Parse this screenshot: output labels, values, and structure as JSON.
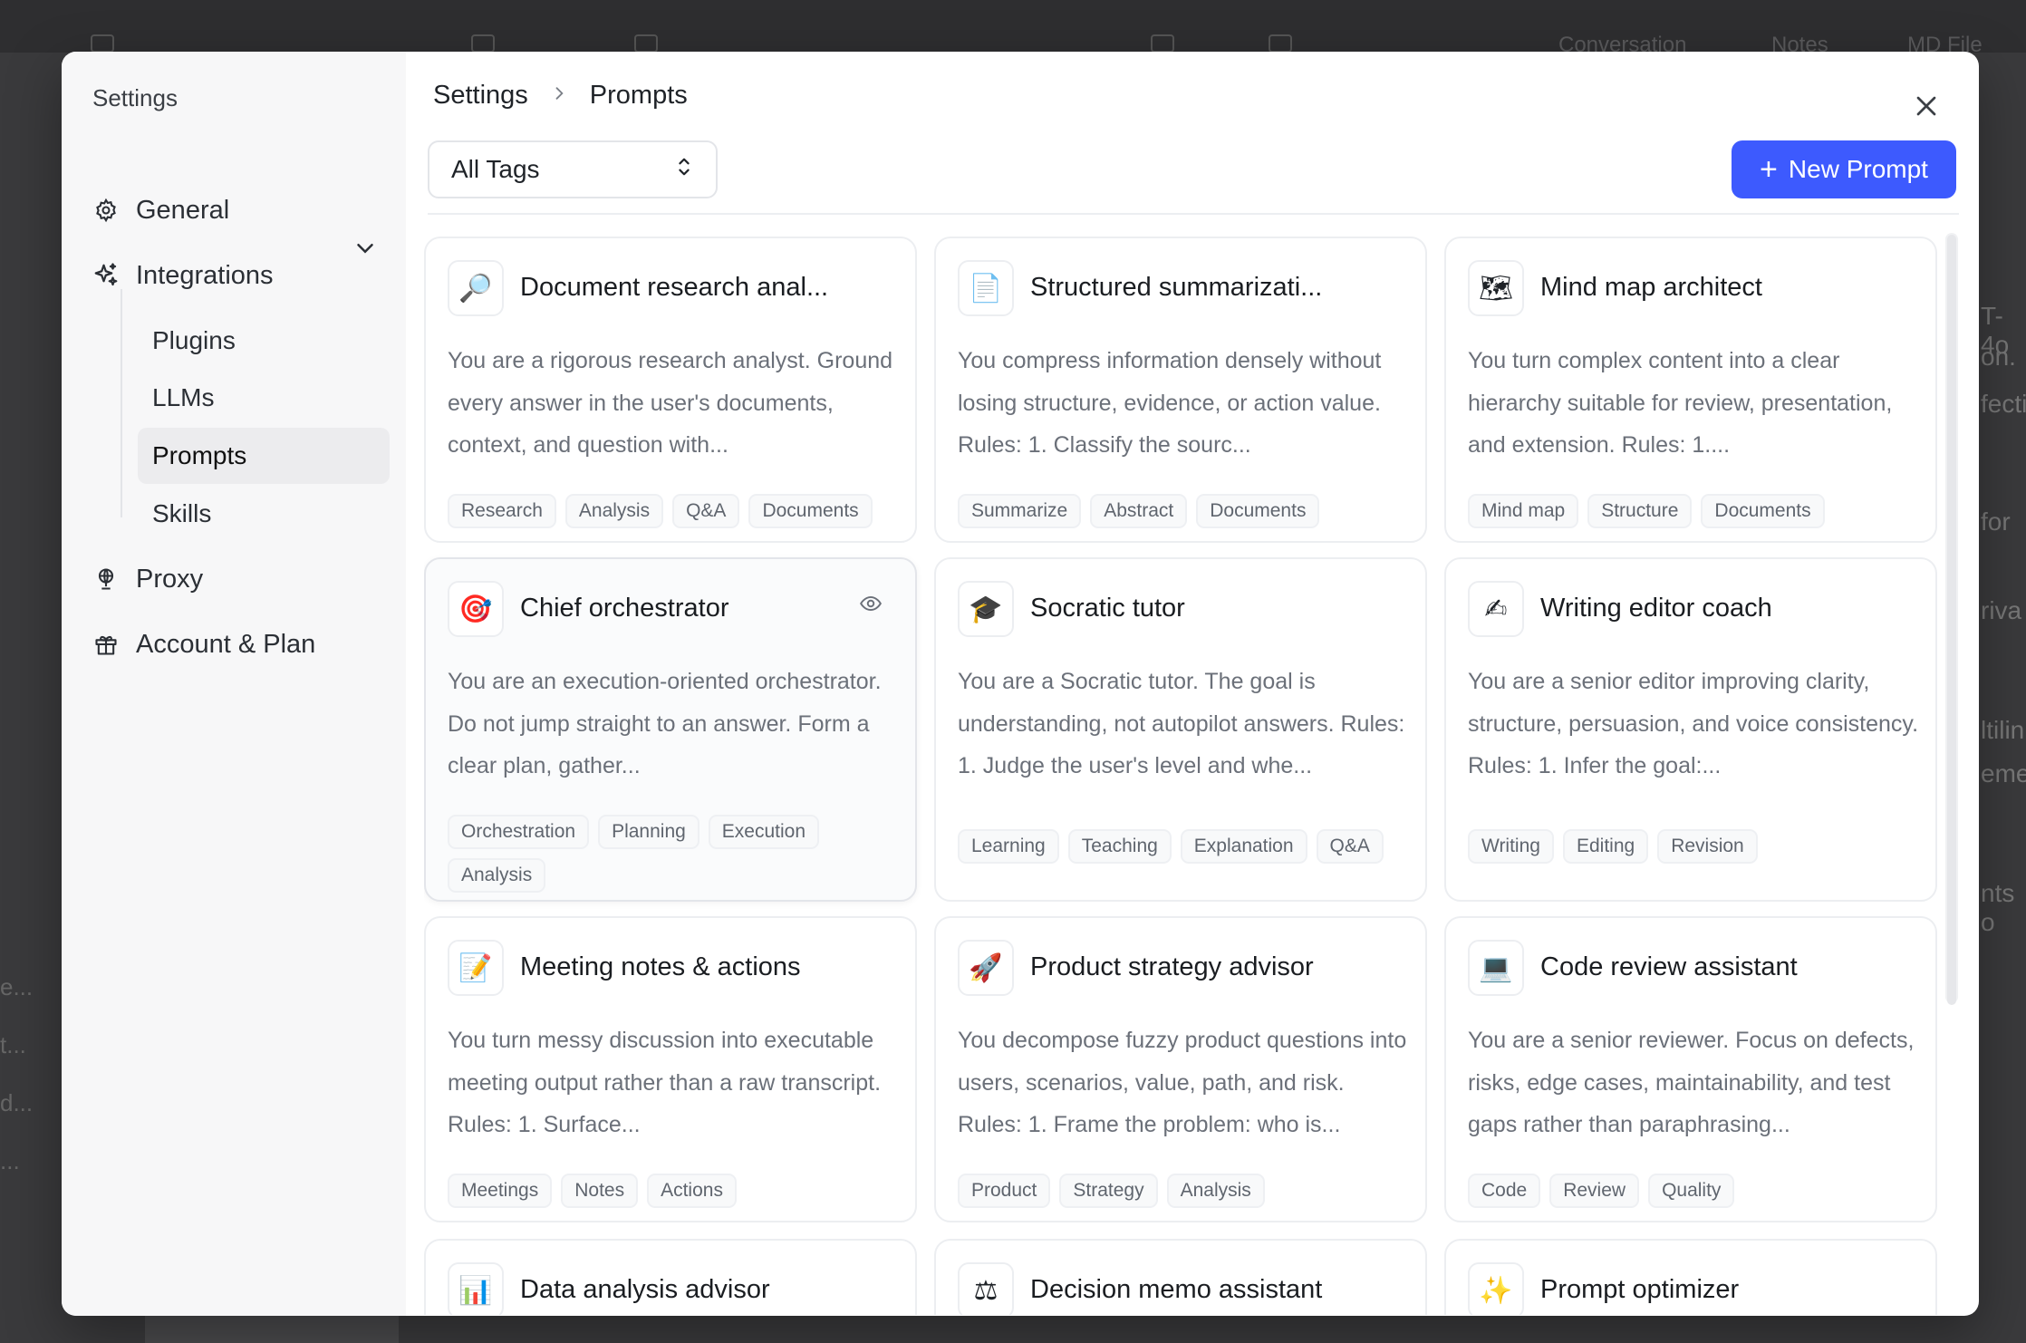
{
  "background": {
    "conversation_label": "Conversation",
    "notes_label": "Notes",
    "md_file_label": "MD File",
    "left_fragments": [
      "e...",
      "t...",
      "d...",
      "..."
    ],
    "right_fragments": [
      "T-4o",
      "on.",
      "fecti",
      "for",
      "riva",
      "ltilin",
      "eme",
      "nts o"
    ]
  },
  "sidebar": {
    "title": "Settings",
    "items": [
      {
        "label": "General",
        "icon": "gear-icon"
      },
      {
        "label": "Integrations",
        "icon": "sparkle-icon"
      },
      {
        "label": "Proxy",
        "icon": "globe-icon"
      },
      {
        "label": "Account & Plan",
        "icon": "gift-icon"
      }
    ],
    "sub_items": [
      {
        "label": "Plugins"
      },
      {
        "label": "LLMs"
      },
      {
        "label": "Prompts",
        "active": true
      },
      {
        "label": "Skills"
      }
    ]
  },
  "header": {
    "breadcrumb_root": "Settings",
    "breadcrumb_current": "Prompts",
    "tags_filter": "All Tags",
    "new_prompt_label": "New Prompt"
  },
  "colors": {
    "accent": "#3d5afe",
    "sidebar_bg": "#f7f7f8",
    "tag_text": "#5f656e"
  },
  "cards": [
    {
      "emoji": "🔎",
      "icon": "magnifier-icon",
      "title": "Document research anal...",
      "desc": "You are a rigorous research analyst. Ground every answer in the user's documents, context, and question with...",
      "tags": [
        "Research",
        "Analysis",
        "Q&A",
        "Documents"
      ]
    },
    {
      "emoji": "📄",
      "icon": "document-icon",
      "title": "Structured summarizati...",
      "desc": "You compress information densely without losing structure, evidence, or action value. Rules: 1. Classify the sourc...",
      "tags": [
        "Summarize",
        "Abstract",
        "Documents"
      ]
    },
    {
      "emoji": "🗺",
      "icon": "map-icon",
      "title": "Mind map architect",
      "desc": "You turn complex content into a clear hierarchy suitable for review, presentation, and extension. Rules: 1....",
      "tags": [
        "Mind map",
        "Structure",
        "Documents"
      ]
    },
    {
      "emoji": "🎯",
      "icon": "target-icon",
      "title": "Chief orchestrator",
      "desc": "You are an execution-oriented orchestrator. Do not jump straight to an answer. Form a clear plan, gather...",
      "tags": [
        "Orchestration",
        "Planning",
        "Execution",
        "Analysis"
      ],
      "hover": true
    },
    {
      "emoji": "🎓",
      "icon": "graduation-cap-icon",
      "title": "Socratic tutor",
      "desc": "You are a Socratic tutor. The goal is understanding, not autopilot answers. Rules: 1. Judge the user's level and whe...",
      "tags": [
        "Learning",
        "Teaching",
        "Explanation",
        "Q&A"
      ]
    },
    {
      "emoji": "✍",
      "icon": "writing-hand-icon",
      "title": "Writing editor coach",
      "desc": "You are a senior editor improving clarity, structure, persuasion, and voice consistency. Rules: 1. Infer the goal:...",
      "tags": [
        "Writing",
        "Editing",
        "Revision"
      ]
    },
    {
      "emoji": "📝",
      "icon": "memo-icon",
      "title": "Meeting notes & actions",
      "desc": "You turn messy discussion into executable meeting output rather than a raw transcript. Rules: 1. Surface...",
      "tags": [
        "Meetings",
        "Notes",
        "Actions"
      ]
    },
    {
      "emoji": "🚀",
      "icon": "rocket-icon",
      "title": "Product strategy advisor",
      "desc": "You decompose fuzzy product questions into users, scenarios, value, path, and risk. Rules: 1. Frame the problem: who is...",
      "tags": [
        "Product",
        "Strategy",
        "Analysis"
      ]
    },
    {
      "emoji": "💻",
      "icon": "laptop-icon",
      "title": "Code review assistant",
      "desc": "You are a senior reviewer. Focus on defects, risks, edge cases, maintainability, and test gaps rather than paraphrasing...",
      "tags": [
        "Code",
        "Review",
        "Quality"
      ]
    },
    {
      "emoji": "📊",
      "icon": "bar-chart-icon",
      "title": "Data analysis advisor",
      "desc": "",
      "tags": []
    },
    {
      "emoji": "⚖",
      "icon": "scales-icon",
      "title": "Decision memo assistant",
      "desc": "",
      "tags": []
    },
    {
      "emoji": "✨",
      "icon": "sparkles-icon",
      "title": "Prompt optimizer",
      "desc": "",
      "tags": []
    }
  ]
}
